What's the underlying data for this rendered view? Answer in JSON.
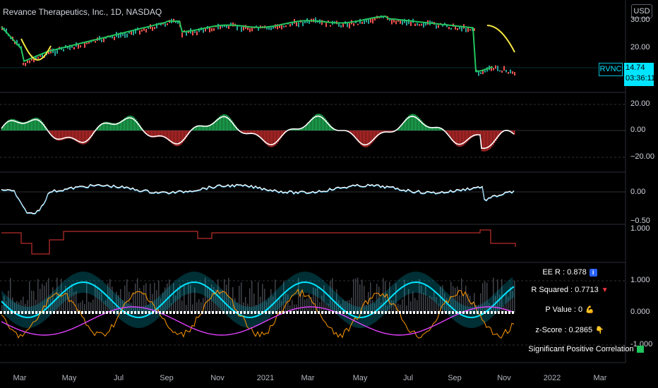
{
  "header": {
    "title": "Revance Therapeutics, Inc., 1D, NASDAQ",
    "currency_button": "USD"
  },
  "price_tag": {
    "symbol": "RVNC",
    "price": "14.74",
    "countdown": "03:36:11"
  },
  "price_axis": [
    "30.00",
    "20.00"
  ],
  "pane2_axis": [
    "20.00",
    "0.00",
    "−20.00"
  ],
  "pane3_axis": [
    "0.00",
    "−0.50"
  ],
  "pane4_axis": [
    "1.000"
  ],
  "pane5_axis": [
    "1.000",
    "0.000",
    "-1.000"
  ],
  "time_axis": [
    "Mar",
    "May",
    "Jul",
    "Sep",
    "Nov",
    "2021",
    "Mar",
    "May",
    "Jul",
    "Sep",
    "Nov",
    "2022",
    "Mar"
  ],
  "stats": {
    "ee_r": "EE R : 0.878",
    "r_squared": "R Squared : 0.7713",
    "p_value": "P Value : 0",
    "z_score": "z-Score : 0.2865",
    "significance": "Significant Positive Correlation"
  },
  "icons": {
    "ee_r": "info-icon",
    "r_squared": "triangle-down-icon",
    "p_value": "flexed-biceps-icon",
    "z_score": "backhand-pointing-down-icon",
    "significance": "green-square-icon"
  },
  "colors": {
    "background": "#000000",
    "accent_cyan": "#00e5ff",
    "up_green": "#22c55e",
    "down_red": "#f23645",
    "ma_yellow": "#f5e642"
  }
}
